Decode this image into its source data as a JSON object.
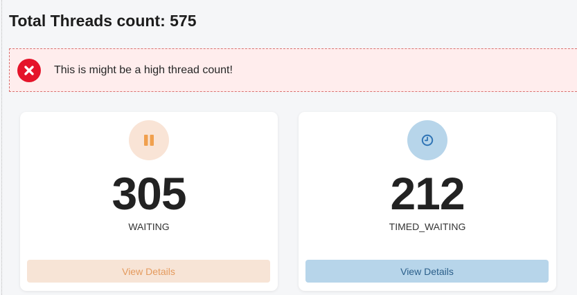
{
  "header": {
    "title": "Total Threads count: 575"
  },
  "alert": {
    "message": "This is might be a high thread count!",
    "icon": "error-x-icon",
    "color": "#e5142a"
  },
  "cards": [
    {
      "count": "305",
      "state": "WAITING",
      "icon": "pause-icon",
      "accent": "#f0a04e",
      "button_label": "View Details"
    },
    {
      "count": "212",
      "state": "TIMED_WAITING",
      "icon": "clock-icon",
      "accent": "#2f74b5",
      "button_label": "View Details"
    }
  ]
}
